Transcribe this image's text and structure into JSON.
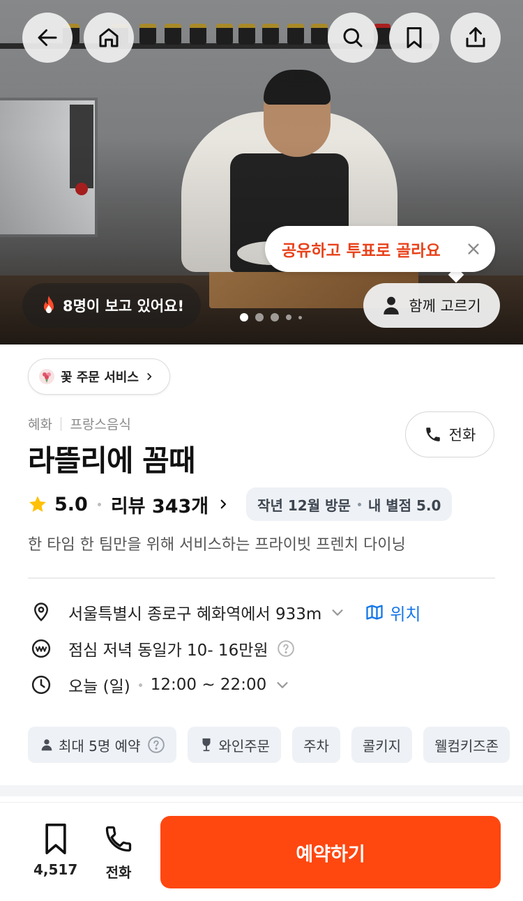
{
  "hero": {
    "tooltip_text": "공유하고 투표로 골라요",
    "viewers_text": "8명이 보고 있어요!",
    "choose_together_label": "함께 고르기",
    "slide_count": 5,
    "active_slide": 1
  },
  "service_chip": {
    "label": "꽃 주문 서비스"
  },
  "category": {
    "area": "혜화",
    "cuisine": "프랑스음식"
  },
  "call_button_label": "전화",
  "restaurant": {
    "name": "라뜰리에 꼼때",
    "rating": "5.0",
    "review_text": "리뷰 343개",
    "visit_badge": {
      "visit": "작년 12월 방문",
      "my_rating": "내 별점 5.0"
    },
    "description": "한 타임 한 팀만을 위해 서비스하는 프라이빗 프렌치 다이닝"
  },
  "info": {
    "address": "서울특별시 종로구 혜화역에서 933m",
    "map_label": "위치",
    "price": "점심 저녁 동일가 10- 16만원",
    "hours_day": "오늘 (일)",
    "hours_time": "12:00 ~ 22:00"
  },
  "tags": [
    {
      "label": "최대 5명 예약",
      "icon": "person-icon",
      "help": true
    },
    {
      "label": "와인주문",
      "icon": "wine-glass-icon",
      "help": false
    },
    {
      "label": "주차",
      "icon": "",
      "help": false
    },
    {
      "label": "콜키지",
      "icon": "",
      "help": false
    },
    {
      "label": "웰컴키즈존",
      "icon": "",
      "help": false
    }
  ],
  "bottom_bar": {
    "bookmark_count": "4,517",
    "call_label": "전화",
    "reserve_label": "예약하기"
  },
  "colors": {
    "accent": "#ff4710",
    "tooltip_text": "#e8421b",
    "link_blue": "#1677e8",
    "star": "#ffc107"
  }
}
